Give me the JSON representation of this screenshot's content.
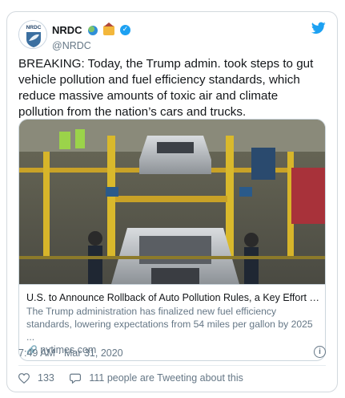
{
  "tweet": {
    "display_name": "NRDC",
    "handle": "@NRDC",
    "avatar_label": "NRDC",
    "verified_glyph": "✓",
    "text": "BREAKING: Today, the Trump admin. took steps to gut vehicle pollution and fuel efficiency standards, which reduce massive amounts of toxic air and climate pollution from the nation’s cars and trucks.",
    "icons": [
      "earth-emoji-icon",
      "house-emoji-icon",
      "verified-badge-icon",
      "twitter-bird-icon"
    ]
  },
  "link_card": {
    "title": "U.S. to Announce Rollback of Auto Pollution Rules, a Key Effort to Fi...",
    "description": "The Trump administration has finalized new fuel efficiency standards, lowering expectations from 54 miles per gallon by 2025 ...",
    "domain": "nytimes.com",
    "link_glyph": "🔗"
  },
  "meta": {
    "timestamp": "7:49 AM · Mar 31, 2020",
    "info_glyph": "i"
  },
  "actions": {
    "likes": "133",
    "replies_text": "111 people are Tweeting about this"
  },
  "colors": {
    "brand_blue": "#1da1f2",
    "text": "#14171a",
    "secondary": "#657786",
    "border": "#ccd6dd"
  }
}
